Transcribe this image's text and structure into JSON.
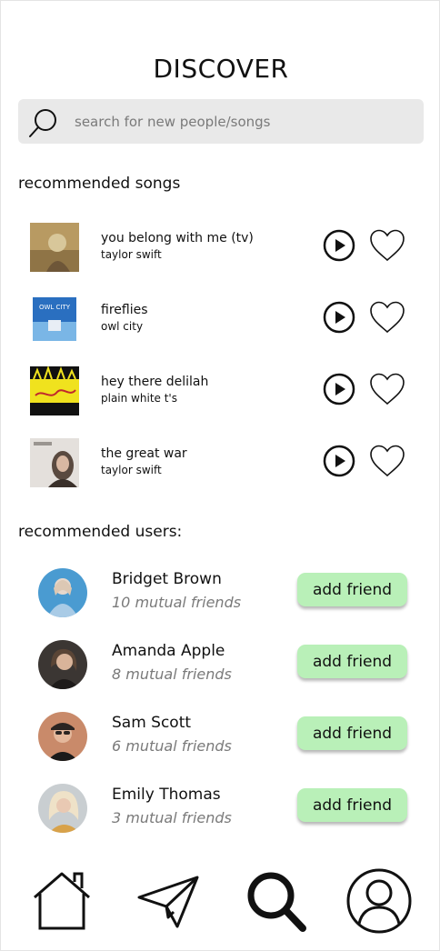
{
  "header": {
    "title": "DISCOVER"
  },
  "search": {
    "placeholder": "search for new people/songs",
    "icon": "search-icon"
  },
  "sections": {
    "songs_heading": "recommended songs",
    "users_heading": "recommended users:"
  },
  "songs": [
    {
      "title": "you belong with me (tv)",
      "artist": "taylor swift",
      "art_color": "#b89a62"
    },
    {
      "title": "fireflies",
      "artist": "owl city",
      "art_color": "#2a6fc0",
      "art_text": "OWL CITY"
    },
    {
      "title": "hey there delilah",
      "artist": "plain white t's",
      "art_color": "#f0e21e"
    },
    {
      "title": "the great war",
      "artist": "taylor swift",
      "art_color": "#d9d4d0"
    }
  ],
  "users": [
    {
      "name": "Bridget Brown",
      "mutual": "10 mutual friends",
      "add_label": "add friend",
      "avatar_color": "#4a9bd1"
    },
    {
      "name": "Amanda Apple",
      "mutual": "8 mutual friends",
      "add_label": "add friend",
      "avatar_color": "#3b3633"
    },
    {
      "name": "Sam Scott",
      "mutual": "6 mutual friends",
      "add_label": "add friend",
      "avatar_color": "#c98a6a"
    },
    {
      "name": "Emily Thomas",
      "mutual": "3 mutual friends",
      "add_label": "add friend",
      "avatar_color": "#c9ced1"
    }
  ],
  "nav": [
    {
      "icon": "home-icon"
    },
    {
      "icon": "paper-plane-icon"
    },
    {
      "icon": "search-icon",
      "active": true
    },
    {
      "icon": "profile-icon"
    }
  ],
  "colors": {
    "add_button": "#b9f0b8",
    "search_bg": "#e9e9e9",
    "muted_text": "#7a7a7a"
  }
}
